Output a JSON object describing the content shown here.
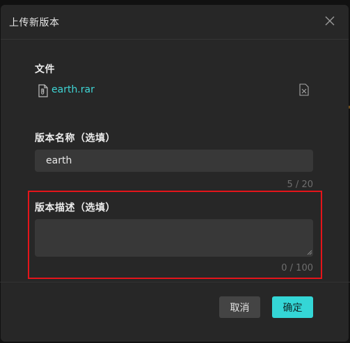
{
  "dialog": {
    "title": "上传新版本",
    "close_icon": "close-icon"
  },
  "file_section": {
    "label": "文件",
    "file_name": "earth.rar",
    "file_icon": "attachment-file-icon",
    "delete_icon": "delete-file-icon"
  },
  "name_section": {
    "label": "版本名称（选填）",
    "value": "earth",
    "counter": "5 / 20"
  },
  "desc_section": {
    "label": "版本描述（选填）",
    "value": "",
    "counter": "0 / 100"
  },
  "footer": {
    "cancel_label": "取消",
    "confirm_label": "确定"
  },
  "colors": {
    "accent": "#34d6d6",
    "highlight": "#e5141a"
  }
}
